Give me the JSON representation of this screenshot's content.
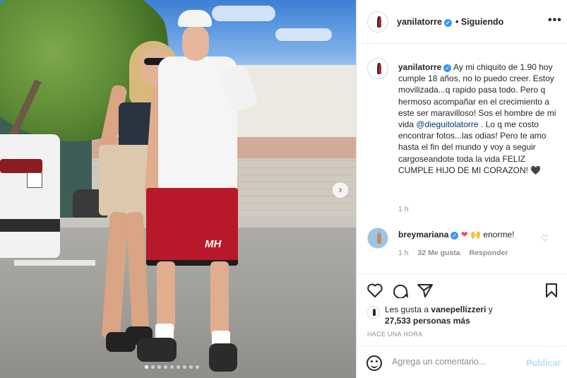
{
  "colors": {
    "accent": "#3897f0",
    "link": "#00376b",
    "muted": "#8e8e8e",
    "heart": "#ed4956",
    "publish_disabled": "#b2dffc"
  },
  "photo": {
    "shorts_logo": "MH",
    "carousel_dots": 9,
    "active_dot": 1
  },
  "header": {
    "username": "yanilatorre",
    "follow_status": "• Siguiendo",
    "more": "•••"
  },
  "caption": {
    "username": "yanilatorre",
    "text_1": "Ay mi chiquito de 1.90 hoy cumple 18 años, no lo puedo creer. Estoy movilizada...q rapido pasa todo. Pero q hermoso acompañar en el crecimiento a este ser maravilloso! Sos el hombre de mi vida",
    "mention": "@dieguitolatorre",
    "text_2": ". Lo q me costo encontrar fotos...las odias! Pero te amo hasta el fin del mundo y voy a seguir cargoseandote toda la vida FELIZ CUMPLE HIJO DE MI CORAZON!",
    "heart": "🖤",
    "time": "1 h"
  },
  "reply": {
    "username": "breymariana",
    "hearts": "❤",
    "hands": "🙌",
    "text": "enorme!",
    "time": "1 h",
    "likes": "32 Me gusta",
    "reply_label": "Responder"
  },
  "actions": {
    "like": "heart-icon",
    "comment": "comment-icon",
    "share": "share-icon",
    "save": "save-icon"
  },
  "likes": {
    "prefix": "Les gusta a",
    "user": "vanepellizzeri",
    "joiner": " y",
    "count": "27,533 personas más"
  },
  "posted": "HACE UNA HORA",
  "comment_bar": {
    "placeholder": "Agrega un comentario...",
    "publish": "Publicar"
  }
}
